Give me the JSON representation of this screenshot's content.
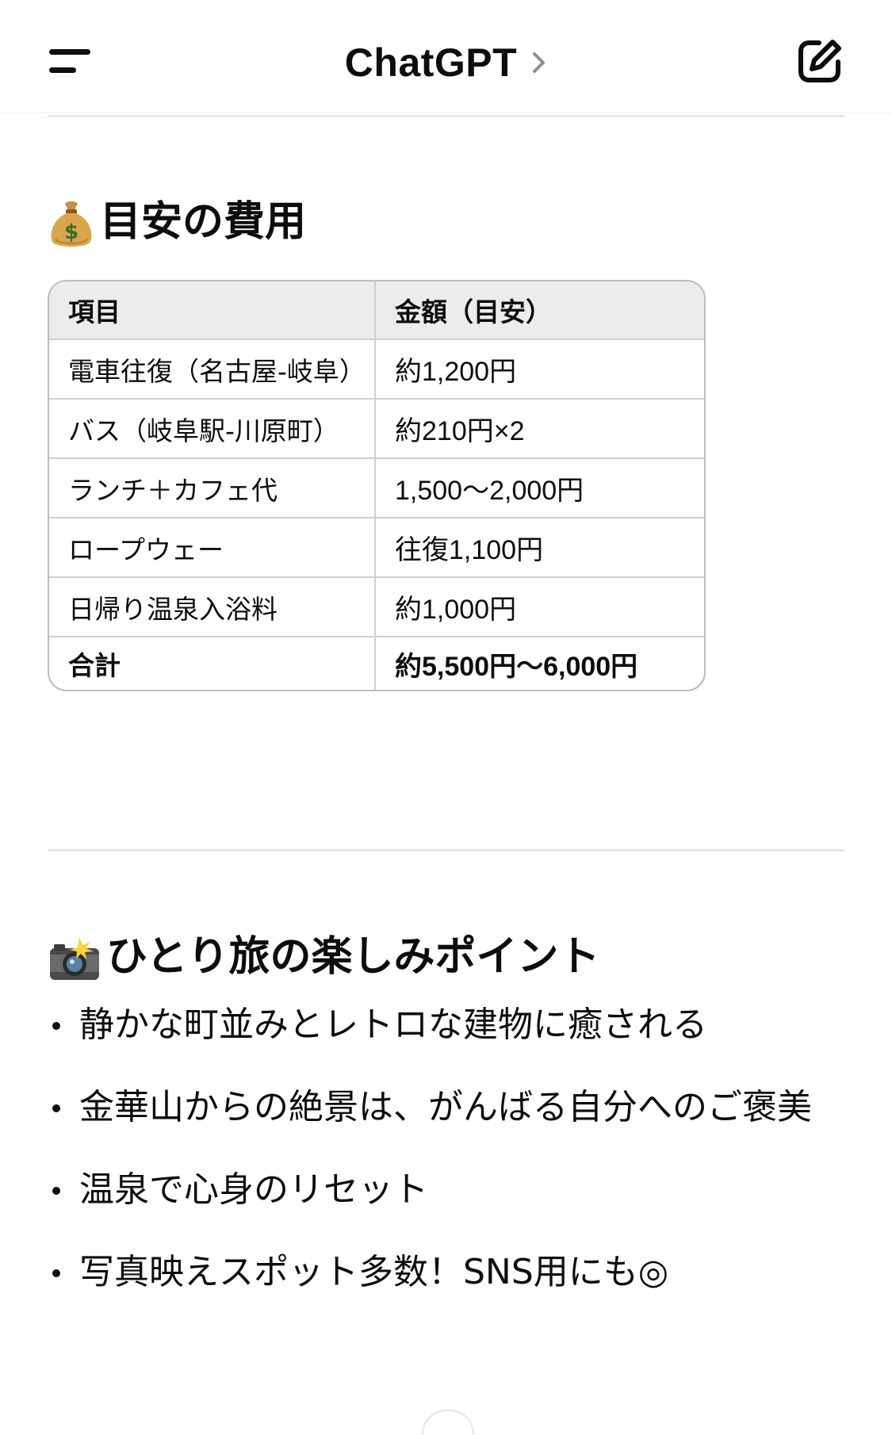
{
  "header": {
    "title": "ChatGPT"
  },
  "cost_section": {
    "icon": "money-bag-icon",
    "heading": "目安の費用",
    "table": {
      "headers": [
        "項目",
        "金額（目安）"
      ],
      "rows": [
        [
          "電車往復（名古屋-岐阜）",
          "約1,200円"
        ],
        [
          "バス（岐阜駅-川原町）",
          "約210円×2"
        ],
        [
          "ランチ＋カフェ代",
          "1,500～2,000円"
        ],
        [
          "ロープウェー",
          "往復1,100円"
        ],
        [
          "日帰り温泉入浴料",
          "約1,000円"
        ]
      ],
      "total": [
        "合計",
        "約5,500円～6,000円"
      ]
    }
  },
  "points_section": {
    "icon": "camera-flash-icon",
    "heading": "ひとり旅の楽しみポイント",
    "items": [
      "静かな町並みとレトロな建物に癒される",
      "金華山からの絶景は、がんばる自分へのご褒美",
      "温泉で心身のリセット",
      "写真映えスポット多数！SNS用にも◎"
    ]
  }
}
